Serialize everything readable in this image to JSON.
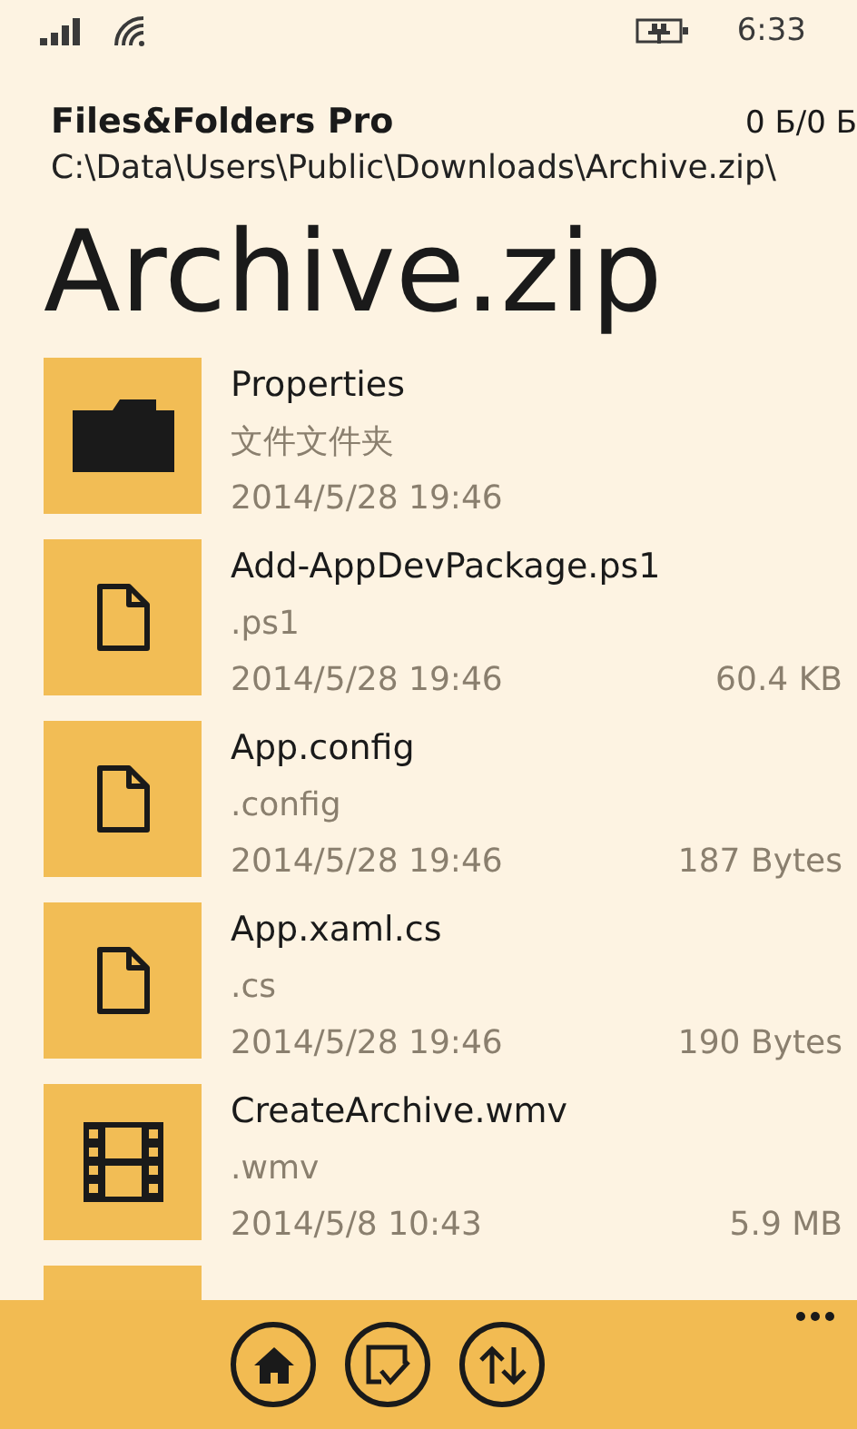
{
  "status_bar": {
    "time": "6:33"
  },
  "app": {
    "title": "Files&Folders Pro",
    "storage": "0 Б/0 Б",
    "path": "C:\\Data\\Users\\Public\\Downloads\\Archive.zip\\"
  },
  "heading": "Archive.zip",
  "items": [
    {
      "kind": "folder",
      "name": "Properties",
      "type": "文件文件夹",
      "date": "2014/5/28 19:46"
    },
    {
      "kind": "file",
      "name": "Add-AppDevPackage.ps1",
      "type": ".ps1",
      "date": "2014/5/28 19:46",
      "size": "60.4 KB"
    },
    {
      "kind": "file",
      "name": "App.config",
      "type": ".config",
      "date": "2014/5/28 19:46",
      "size": "187 Bytes"
    },
    {
      "kind": "file",
      "name": "App.xaml.cs",
      "type": ".cs",
      "date": "2014/5/28 19:46",
      "size": "190 Bytes"
    },
    {
      "kind": "video",
      "name": "CreateArchive.wmv",
      "type": ".wmv",
      "date": "2014/5/8 10:43",
      "size": "5.9 MB"
    },
    {
      "kind": "blank"
    }
  ],
  "app_bar": {
    "buttons": [
      {
        "kind": "home"
      },
      {
        "kind": "select"
      },
      {
        "kind": "sort"
      }
    ]
  }
}
